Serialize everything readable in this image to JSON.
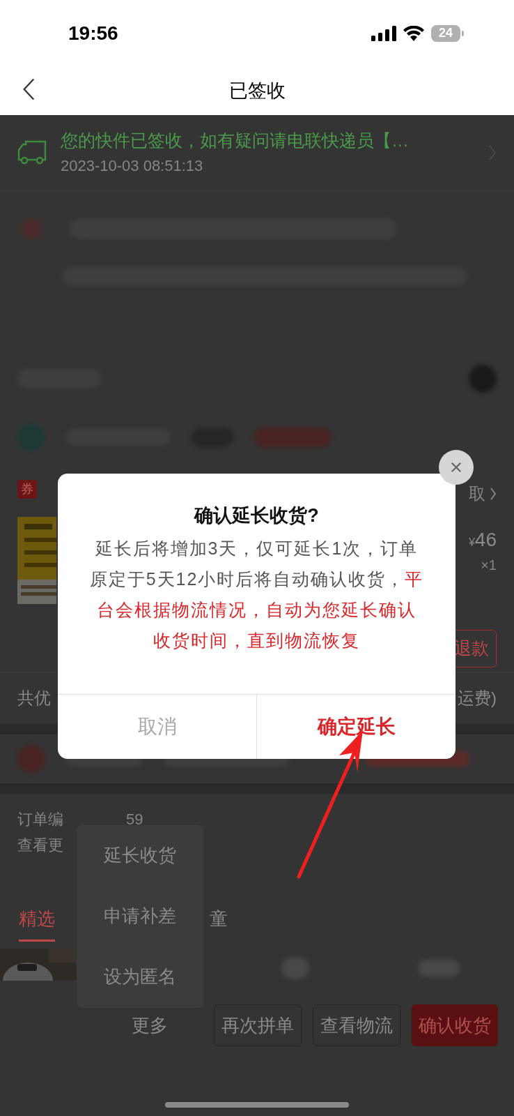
{
  "status_bar": {
    "time": "19:56",
    "battery": "24"
  },
  "nav": {
    "title": "已签收"
  },
  "tracking": {
    "message": "您的快件已签收，如有疑问请电联快递员【…",
    "time": "2023-10-03 08:51:13"
  },
  "coupon": {
    "badge": "券",
    "action": "取"
  },
  "product": {
    "currency": "¥",
    "price": "46",
    "quantity": "×1",
    "refund": "退款"
  },
  "discount": {
    "label": "共优",
    "shipping": "运费)"
  },
  "order": {
    "number_label": "订单编",
    "number_tail": "59",
    "more": "查看更"
  },
  "tabs": [
    {
      "label": "精选",
      "selected": true
    },
    {
      "label": "童",
      "selected": false
    }
  ],
  "menu": {
    "items": [
      "延长收货",
      "申请补差",
      "设为匿名"
    ]
  },
  "bottom_bar": {
    "more": "更多",
    "buttons": [
      {
        "label": "再次拼单",
        "kind": "outline"
      },
      {
        "label": "查看物流",
        "kind": "outline"
      },
      {
        "label": "确认收货",
        "kind": "primary"
      }
    ]
  },
  "dialog": {
    "title": "确认延长收货?",
    "body": "延长后将增加3天，仅可延长1次，订单原定于5天12小时后将自动确认收货，",
    "highlight": "平台会根据物流情况，自动为您延长确认收货时间，直到物流恢复",
    "buttons": [
      {
        "label": "取消",
        "kind": "cancel"
      },
      {
        "label": "确定延长",
        "kind": "confirm"
      }
    ]
  }
}
